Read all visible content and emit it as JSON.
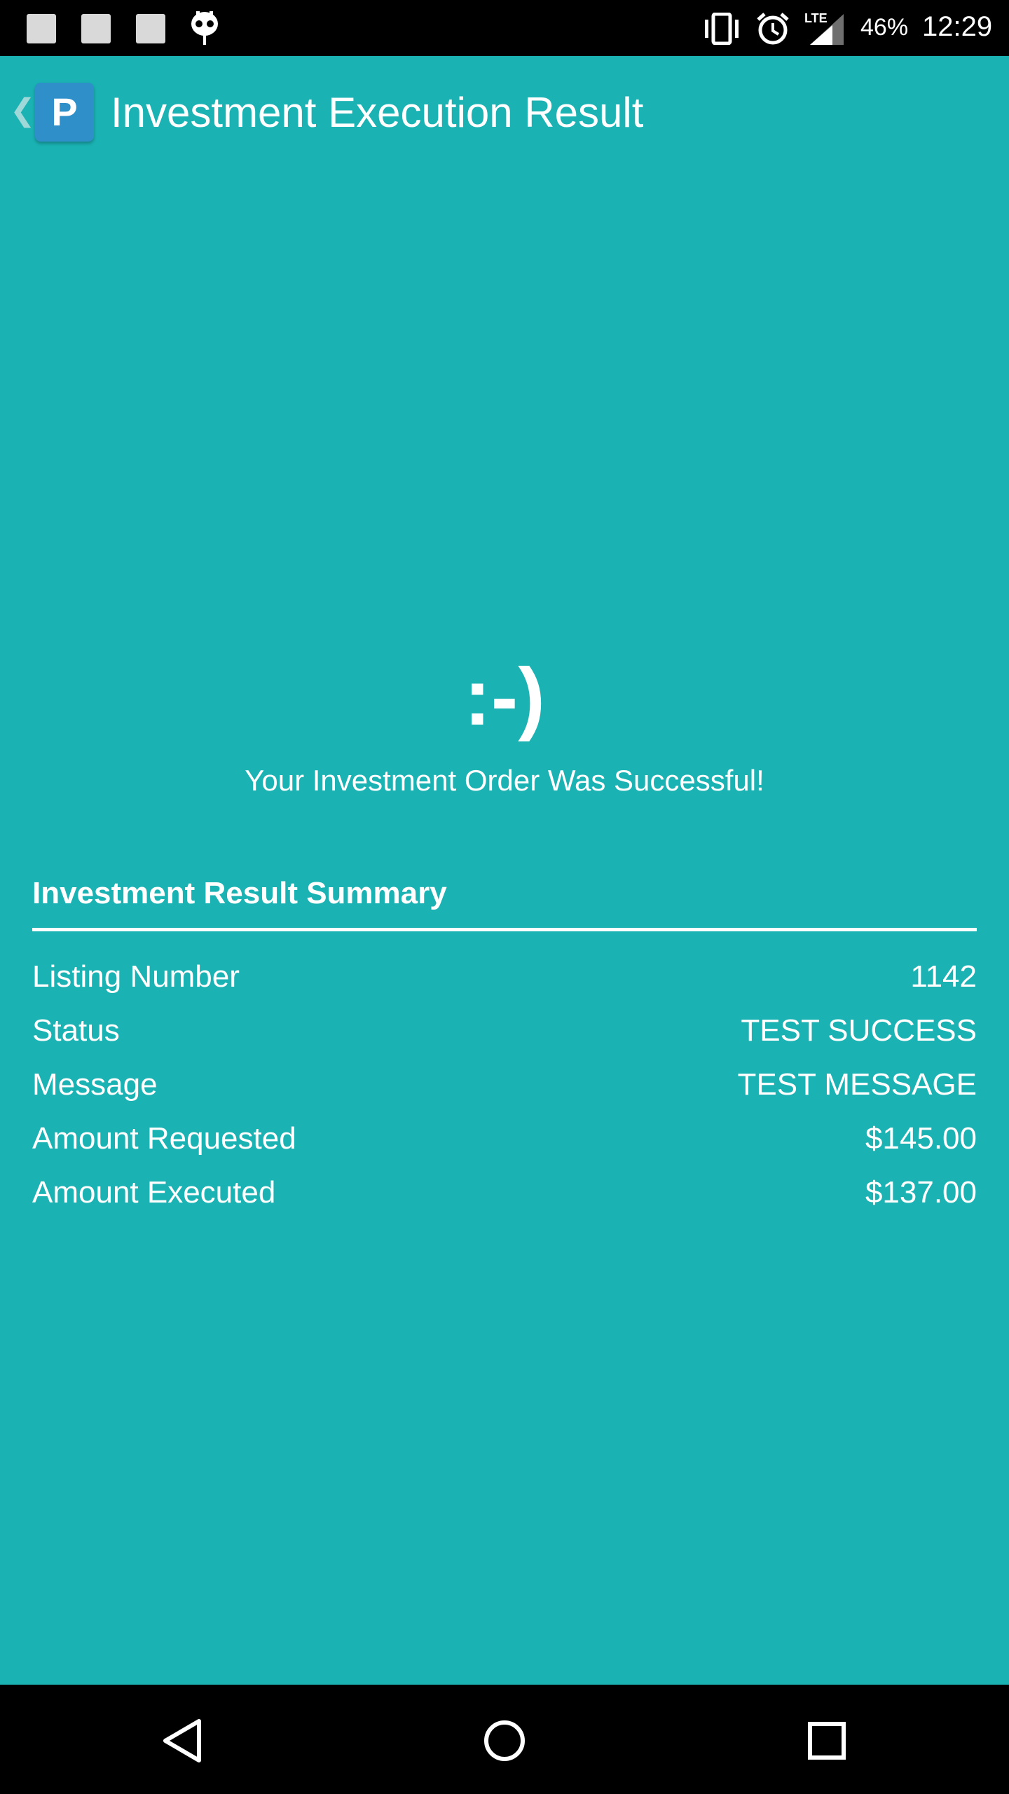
{
  "status_bar": {
    "battery_percent": "46%",
    "time": "12:29",
    "network": "LTE",
    "icons": [
      "notification-icon",
      "notification-icon",
      "notification-icon",
      "cyanogen-icon",
      "vibrate-icon",
      "alarm-icon",
      "lte-signal-icon"
    ]
  },
  "action_bar": {
    "back_icon": "chevron-left-icon",
    "logo_letter": "P",
    "title": "Investment Execution Result"
  },
  "result": {
    "emoticon": ":-)",
    "message": "Your Investment Order Was Successful!"
  },
  "summary": {
    "title": "Investment Result Summary",
    "rows": [
      {
        "label": "Listing Number",
        "value": "1142"
      },
      {
        "label": "Status",
        "value": "TEST SUCCESS"
      },
      {
        "label": "Message",
        "value": "TEST MESSAGE"
      },
      {
        "label": "Amount Requested",
        "value": "$145.00"
      },
      {
        "label": "Amount Executed",
        "value": "$137.00"
      }
    ]
  },
  "nav_bar": {
    "icons": [
      "back-triangle-icon",
      "home-circle-icon",
      "recents-square-icon"
    ]
  },
  "colors": {
    "background": "#1ab2b3",
    "status_bar": "#000000",
    "logo": "#2f8fc8",
    "text": "#ffffff"
  }
}
